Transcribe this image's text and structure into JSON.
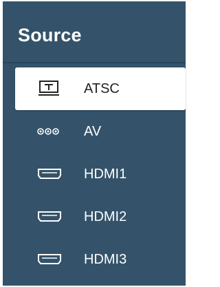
{
  "panel": {
    "title": "Source",
    "items": [
      {
        "label": "ATSC",
        "icon": "tv-antenna-icon",
        "selected": true
      },
      {
        "label": "AV",
        "icon": "composite-av-icon",
        "selected": false
      },
      {
        "label": "HDMI1",
        "icon": "hdmi-port-icon",
        "selected": false
      },
      {
        "label": "HDMI2",
        "icon": "hdmi-port-icon",
        "selected": false
      },
      {
        "label": "HDMI3",
        "icon": "hdmi-port-icon",
        "selected": false
      }
    ]
  },
  "colors": {
    "panel_background": "#34536a",
    "selected_background": "#ffffff",
    "text_default": "#ffffff",
    "text_selected": "#222222"
  }
}
